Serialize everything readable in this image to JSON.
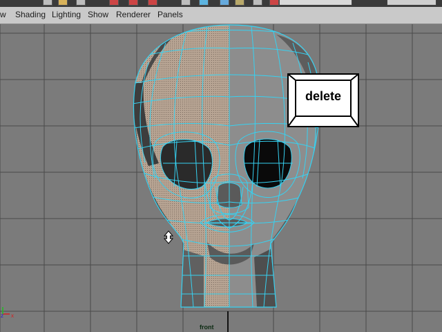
{
  "menubar": {
    "items": [
      {
        "label": "w"
      },
      {
        "label": "Shading"
      },
      {
        "label": "Lighting"
      },
      {
        "label": "Show"
      },
      {
        "label": "Renderer"
      },
      {
        "label": "Panels"
      }
    ]
  },
  "overlay": {
    "key_label": "delete"
  },
  "viewport": {
    "camera_label": "front",
    "axis": {
      "z": "z",
      "x": "x"
    }
  },
  "colors": {
    "wireframe": "#36d2f2",
    "grid": "#4a4a4a",
    "background": "#7b7b7b",
    "selected_faces": "#b7a493",
    "axis_x": "#d62020",
    "axis_y": "#20c020",
    "axis_z": "#2020d0"
  },
  "icons": {
    "cursor": "move-cursor-icon"
  }
}
